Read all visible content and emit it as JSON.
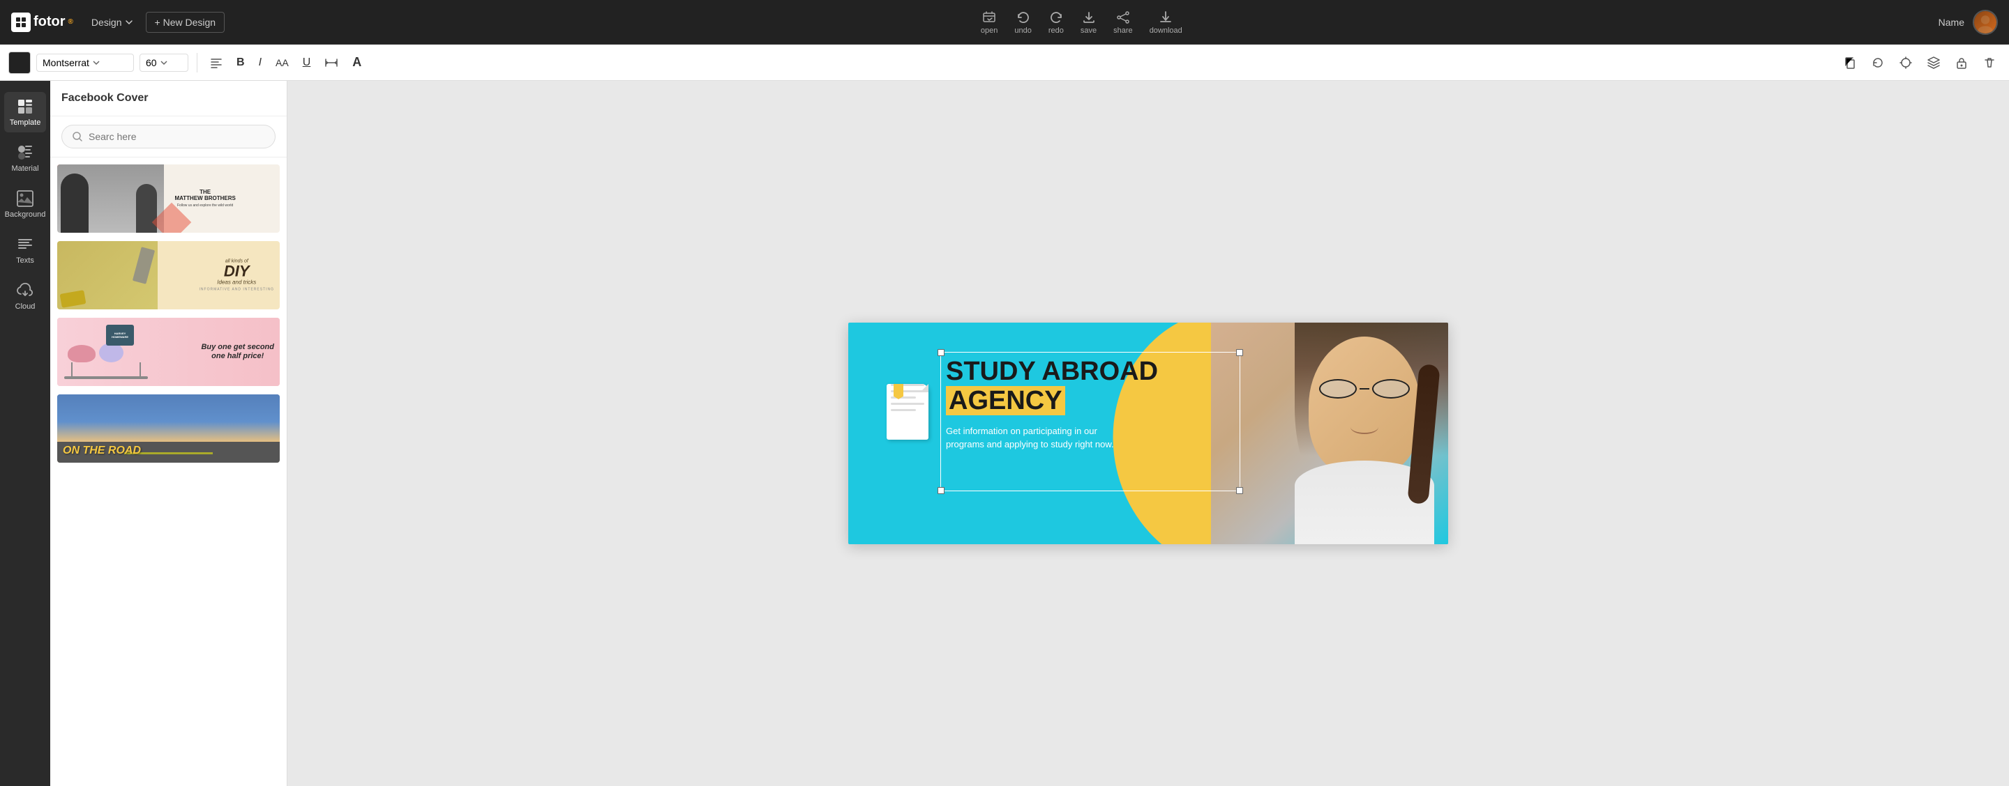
{
  "app": {
    "logo": "fotor",
    "logo_superscript": "®"
  },
  "top_toolbar": {
    "design_label": "Design",
    "new_design_label": "+ New Design",
    "actions": [
      {
        "id": "open",
        "label": "open"
      },
      {
        "id": "undo",
        "label": "undo"
      },
      {
        "id": "redo",
        "label": "redo"
      },
      {
        "id": "save",
        "label": "save"
      },
      {
        "id": "share",
        "label": "share"
      },
      {
        "id": "download",
        "label": "download"
      }
    ],
    "user_name": "Name"
  },
  "secondary_toolbar": {
    "font": "Montserrat",
    "font_size": "60",
    "bold_label": "B",
    "italic_label": "I",
    "underline_label": "U"
  },
  "left_sidebar": {
    "items": [
      {
        "id": "template",
        "label": "Template",
        "active": true
      },
      {
        "id": "material",
        "label": "Material",
        "active": false
      },
      {
        "id": "background",
        "label": "Background",
        "active": false
      },
      {
        "id": "texts",
        "label": "Texts",
        "active": false
      },
      {
        "id": "cloud",
        "label": "Cloud",
        "active": false
      }
    ]
  },
  "left_panel": {
    "title": "Facebook Cover",
    "search_placeholder": "Searc here",
    "templates": [
      {
        "id": "tpl1",
        "name": "Matthew Brothers"
      },
      {
        "id": "tpl2",
        "name": "DIY Ideas"
      },
      {
        "id": "tpl3",
        "name": "Buy One"
      },
      {
        "id": "tpl4",
        "name": "On The Road"
      }
    ]
  },
  "canvas": {
    "headline_line1": "STUDY ABROAD",
    "headline_line2": "AGENCY",
    "subtitle": "Get information on participating in our\nprograms and applying to study right now.",
    "colors": {
      "background": "#1ec8e0",
      "accent_yellow": "#f5c842",
      "text_dark": "#1a1a1a",
      "text_white": "#ffffff"
    }
  },
  "tpl1": {
    "title_line1": "THE",
    "title_line2": "MATTHEW BROTHERS",
    "sub": "Follow us and explore the wild world"
  },
  "tpl2": {
    "prefix": "all kinds of",
    "main": "DIY",
    "suffix": "Ideas and tricks",
    "note": "INFORMATIVE AND INTERESTING"
  },
  "tpl3": {
    "line1": "Buy one get second",
    "line2": "one half price!",
    "brand": "HARVEY HOMEWARE"
  },
  "tpl4": {
    "text": "ON THE ROAD"
  }
}
